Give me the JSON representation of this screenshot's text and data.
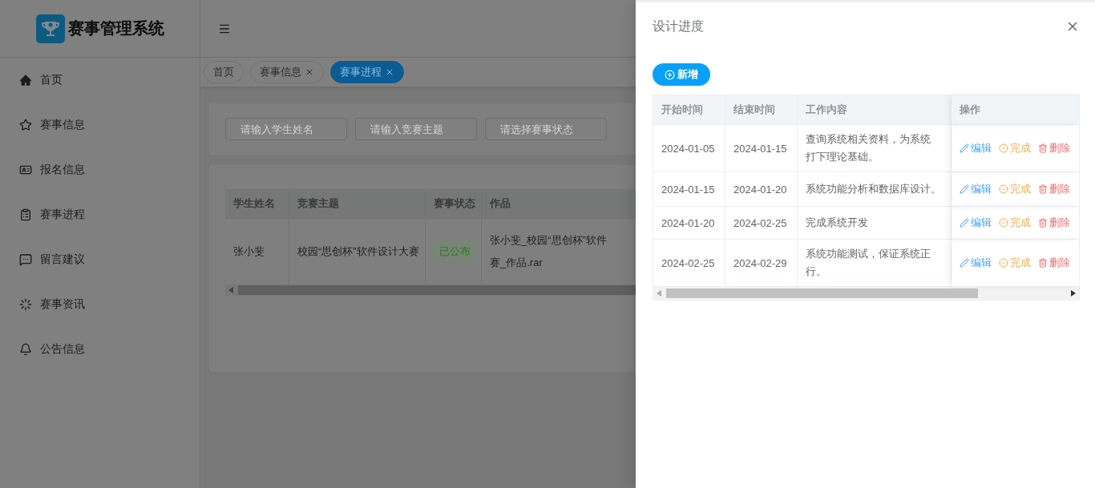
{
  "app": {
    "title": "赛事管理系统"
  },
  "sidebar": {
    "items": [
      {
        "label": "首页"
      },
      {
        "label": "赛事信息"
      },
      {
        "label": "报名信息"
      },
      {
        "label": "赛事进程"
      },
      {
        "label": "留言建议"
      },
      {
        "label": "赛事资讯"
      },
      {
        "label": "公告信息"
      }
    ]
  },
  "tabs": [
    {
      "label": "首页",
      "selected": false,
      "closable": false
    },
    {
      "label": "赛事信息",
      "selected": false,
      "closable": true
    },
    {
      "label": "赛事进程",
      "selected": true,
      "closable": true
    }
  ],
  "filters": [
    {
      "placeholder": "请输入学生姓名"
    },
    {
      "placeholder": "请输入竞赛主题"
    },
    {
      "placeholder": "请选择赛事状态"
    }
  ],
  "table": {
    "columns": [
      "学生姓名",
      "竞赛主题",
      "赛事状态",
      "作品"
    ],
    "rows": [
      {
        "student": "张小斐",
        "topic": "校园“思创杯”软件设计大赛",
        "status": {
          "label": "已公布",
          "kind": "success"
        },
        "work": [
          "张小斐_校园“思创杯”软件",
          "赛_作品.rar"
        ]
      }
    ]
  },
  "drawer": {
    "title": "设计进度",
    "add_button": "新增",
    "columns": [
      "开始时间",
      "结束时间",
      "工作内容",
      "操作"
    ],
    "rows": [
      {
        "start": "2024-01-05",
        "end": "2024-01-15",
        "content": [
          "查询系统相关资料，为系统",
          "打下理论基础。"
        ],
        "actions": [
          {
            "label": "编辑",
            "kind": "edit"
          },
          {
            "label": "完成",
            "kind": "done"
          },
          {
            "label": "删除",
            "kind": "delete"
          }
        ]
      },
      {
        "start": "2024-01-15",
        "end": "2024-01-20",
        "content": [
          "系统功能分析和数据库设计。"
        ],
        "actions": [
          {
            "label": "编辑",
            "kind": "edit"
          },
          {
            "label": "完成",
            "kind": "done"
          },
          {
            "label": "删除",
            "kind": "delete"
          }
        ]
      },
      {
        "start": "2024-01-20",
        "end": "2024-02-25",
        "content": [
          "完成系统开发"
        ],
        "actions": [
          {
            "label": "编辑",
            "kind": "edit"
          },
          {
            "label": "完成",
            "kind": "done"
          },
          {
            "label": "删除",
            "kind": "delete"
          }
        ]
      },
      {
        "start": "2024-02-25",
        "end": "2024-02-29",
        "content": [
          "系统功能测试，保证系统正",
          "行。"
        ],
        "actions": [
          {
            "label": "编辑",
            "kind": "edit"
          },
          {
            "label": "完成",
            "kind": "done"
          },
          {
            "label": "删除",
            "kind": "delete"
          }
        ]
      }
    ]
  }
}
